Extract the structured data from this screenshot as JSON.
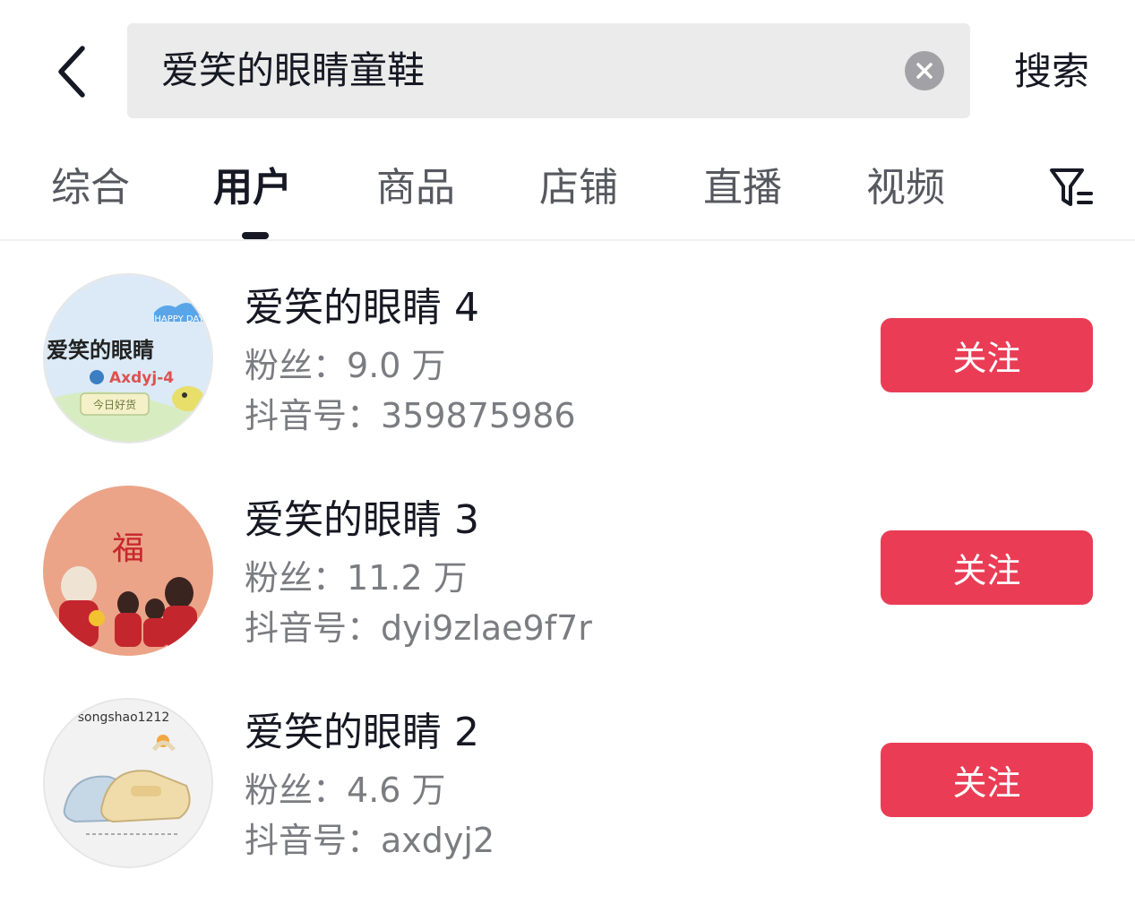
{
  "header": {
    "back_icon": "chevron-left-icon",
    "search_value": "爱笑的眼睛童鞋",
    "clear_icon": "clear-circle-icon",
    "search_label": "搜索"
  },
  "tabs": [
    {
      "label": "综合",
      "active": false
    },
    {
      "label": "用户",
      "active": true
    },
    {
      "label": "商品",
      "active": false
    },
    {
      "label": "店铺",
      "active": false
    },
    {
      "label": "直播",
      "active": false
    },
    {
      "label": "视频",
      "active": false
    }
  ],
  "filter_icon": "filter-icon",
  "users": [
    {
      "name": "爱笑的眼睛 4",
      "fans_label": "粉丝：",
      "fans": "9.0 万",
      "id_label": "抖音号：",
      "id": "359875986",
      "follow_label": "关注",
      "avatar": {
        "title": "爱笑的眼睛",
        "sub": "Axdyj-4",
        "badge": "HAPPY DAY",
        "footer": "今日好货"
      }
    },
    {
      "name": "爱笑的眼睛 3",
      "fans_label": "粉丝：",
      "fans": "11.2 万",
      "id_label": "抖音号：",
      "id": "dyi9zlae9f7r",
      "follow_label": "关注",
      "avatar": {
        "glyph": "福"
      }
    },
    {
      "name": "爱笑的眼睛 2",
      "fans_label": "粉丝：",
      "fans": "4.6 万",
      "id_label": "抖音号：",
      "id": "axdyj2",
      "follow_label": "关注",
      "avatar": {
        "caption": "songshao1212"
      }
    }
  ],
  "colors": {
    "accent": "#ea3d55",
    "search_bg": "#ebebeb",
    "primary_text": "#161823",
    "secondary_text": "#7b7c81"
  }
}
